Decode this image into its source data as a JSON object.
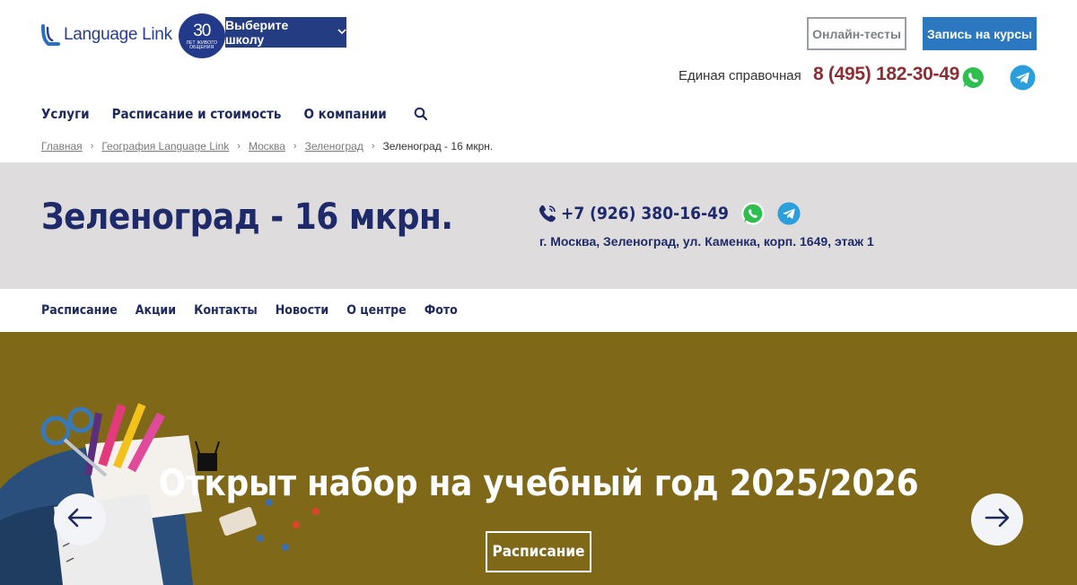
{
  "header": {
    "logo_text": "Language Link",
    "badge_number": "30",
    "badge_sub": "ЛЕТ ЖИВОГО ОБЩЕНИЯ",
    "school_select_label": "Выберите школу",
    "online_tests_label": "Онлайн-тесты",
    "enroll_label": "Запись на курсы",
    "help_label": "Единая справочная",
    "help_phone": "8 (495) 182-30-49"
  },
  "main_nav": {
    "items": [
      {
        "label": "Услуги"
      },
      {
        "label": "Расписание и стоимость"
      },
      {
        "label": "О компании"
      }
    ]
  },
  "breadcrumb": {
    "items": [
      {
        "label": "Главная"
      },
      {
        "label": "География Language Link"
      },
      {
        "label": "Москва"
      },
      {
        "label": "Зеленоград"
      },
      {
        "label": "Зеленоград - 16 мкрн."
      }
    ]
  },
  "school": {
    "title": "Зеленоград - 16 мкрн.",
    "phone": "+7 (926) 380-16-49",
    "address": "г. Москва, Зеленоград, ул. Каменка, корп. 1649, этаж 1"
  },
  "sub_nav": {
    "items": [
      {
        "label": "Расписание"
      },
      {
        "label": "Акции"
      },
      {
        "label": "Контакты"
      },
      {
        "label": "Новости"
      },
      {
        "label": "О центре"
      },
      {
        "label": "Фото"
      }
    ]
  },
  "banner": {
    "title": "Открыт набор на учебный год 2025/2026",
    "button_label": "Расписание"
  },
  "colors": {
    "brand_navy": "#243c82",
    "accent_blue": "#2b78c0",
    "phone_red": "#8c2f35",
    "band_gray": "#dedcdc",
    "banner_olive": "#7f6817"
  },
  "icons": [
    "logo-mark-icon",
    "chevron-down-icon",
    "whatsapp-icon",
    "telegram-icon",
    "search-icon",
    "phone-icon",
    "arrow-left-icon",
    "arrow-right-icon"
  ]
}
